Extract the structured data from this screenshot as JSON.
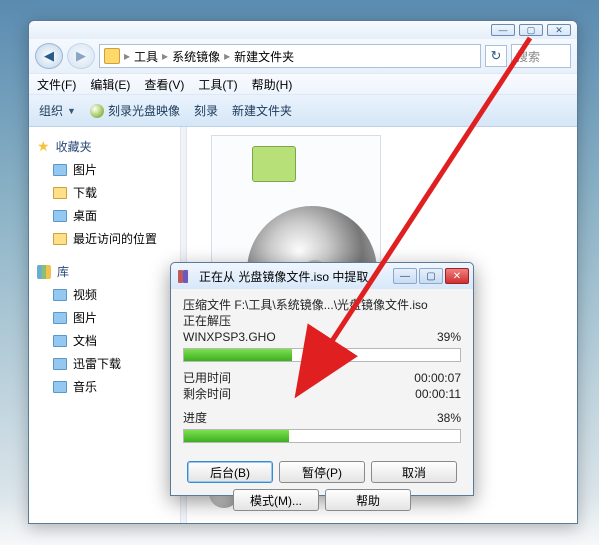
{
  "window_controls": {
    "min": "—",
    "max": "▢",
    "close": "✕"
  },
  "breadcrumb": {
    "seg1": "工具",
    "seg2": "系统镜像",
    "seg3": "新建文件夹",
    "sep": "▸"
  },
  "search": {
    "placeholder": "搜索"
  },
  "menubar": {
    "file": "文件(F)",
    "edit": "编辑(E)",
    "view": "查看(V)",
    "tools": "工具(T)",
    "help": "帮助(H)"
  },
  "toolbar": {
    "organize": "组织",
    "burn": "刻录光盘映像",
    "record": "刻录",
    "newfolder": "新建文件夹"
  },
  "sidebar": {
    "favorites_head": "收藏夹",
    "favorites": [
      "图片",
      "下载",
      "桌面",
      "最近访问的位置"
    ],
    "libraries_head": "库",
    "libraries": [
      "视频",
      "图片",
      "文档",
      "迅雷下载",
      "音乐"
    ]
  },
  "selected": {
    "name": "光盘",
    "sub": "光盘"
  },
  "dialog": {
    "title": "正在从 光盘镜像文件.iso 中提取",
    "archive_label": "压缩文件",
    "archive_path": "F:\\工具\\系统镜像...\\光盘镜像文件.iso",
    "extracting": "正在解压",
    "current_file": "WINXPSP3.GHO",
    "file_percent": "39%",
    "elapsed_label": "已用时间",
    "elapsed_value": "00:00:07",
    "remain_label": "剩余时间",
    "remain_value": "00:00:11",
    "progress_label": "进度",
    "total_percent": "38%",
    "buttons": {
      "background": "后台(B)",
      "pause": "暂停(P)",
      "cancel": "取消",
      "mode": "模式(M)...",
      "help": "帮助"
    },
    "progress_values": {
      "file_pct": 39,
      "total_pct": 38
    }
  }
}
